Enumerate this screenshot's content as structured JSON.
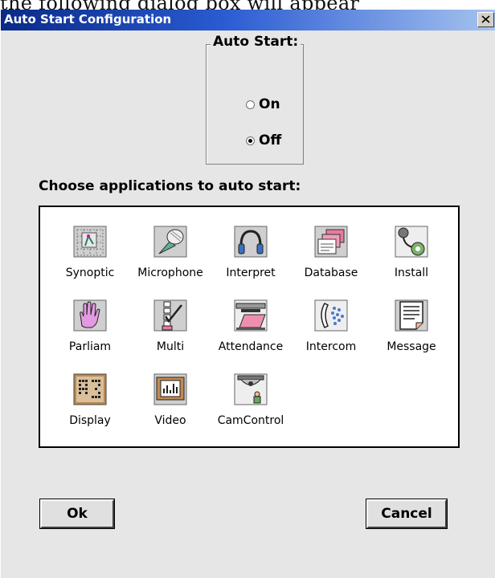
{
  "background_text": "the following dialog box will appear",
  "window": {
    "title": "Auto Start Configuration"
  },
  "auto_start": {
    "legend": "Auto Start:",
    "options": [
      {
        "label": "On",
        "checked": false
      },
      {
        "label": "Off",
        "checked": true
      }
    ]
  },
  "choose_label": "Choose applications to auto start:",
  "apps": [
    {
      "label": "Synoptic",
      "icon": "synoptic-icon"
    },
    {
      "label": "Microphone",
      "icon": "microphone-icon"
    },
    {
      "label": "Interpret",
      "icon": "headphones-icon"
    },
    {
      "label": "Database",
      "icon": "database-icon"
    },
    {
      "label": "Install",
      "icon": "install-icon"
    },
    {
      "label": "Parliam",
      "icon": "hand-icon"
    },
    {
      "label": "Multi",
      "icon": "checklist-icon"
    },
    {
      "label": "Attendance",
      "icon": "attendance-icon"
    },
    {
      "label": "Intercom",
      "icon": "intercom-icon"
    },
    {
      "label": "Message",
      "icon": "message-icon"
    },
    {
      "label": "Display",
      "icon": "display-icon"
    },
    {
      "label": "Video",
      "icon": "video-icon"
    },
    {
      "label": "CamControl",
      "icon": "camera-icon"
    }
  ],
  "buttons": {
    "ok": "Ok",
    "cancel": "Cancel"
  }
}
